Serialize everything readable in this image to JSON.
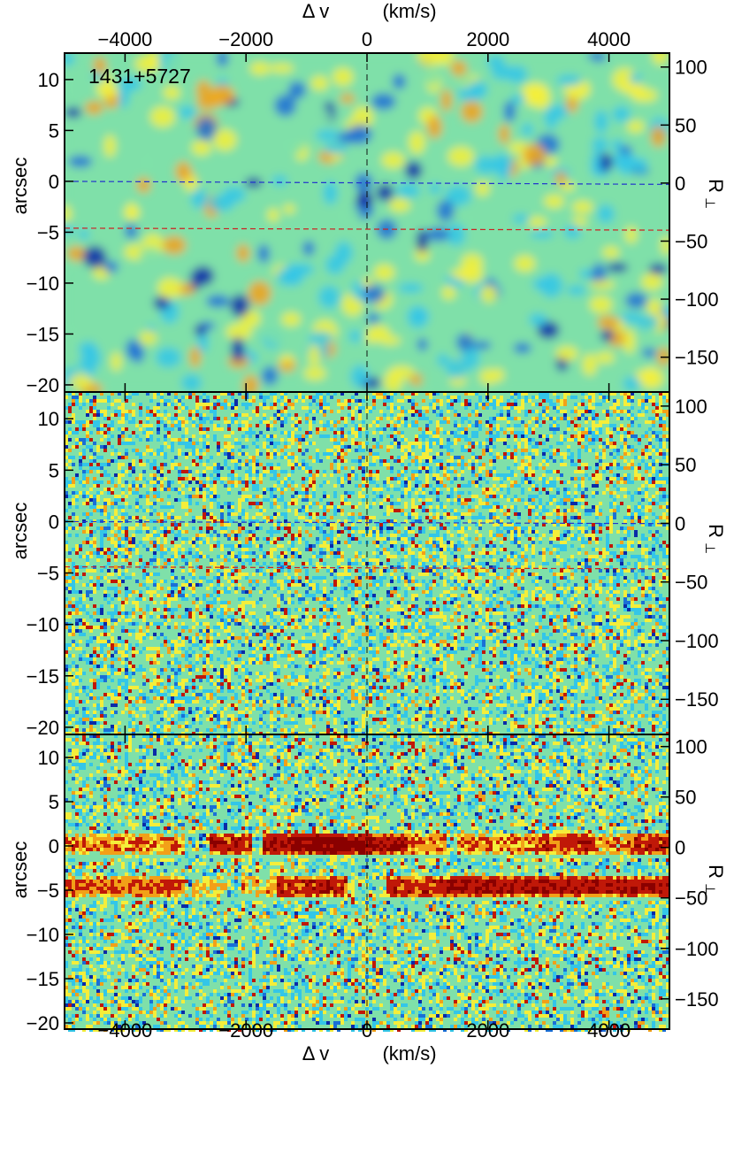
{
  "chart_data": {
    "type": "heatmap",
    "object_label": "1431+5727",
    "colors": {
      "field": "#7fe0a9",
      "blue_dark": "#0a2aa8",
      "blue": "#1a6fd6",
      "cyan": "#33c6e8",
      "yellow": "#f4ee3a",
      "orange": "#f2a018",
      "red": "#c01808",
      "dark_red": "#8a0000",
      "dash_blue": "#2233cc",
      "dash_red": "#cc2222"
    },
    "x_axis": {
      "label_delta": "Δ v",
      "label_units": "(km/s)",
      "range": [
        -5000,
        5000
      ],
      "ticks": [
        -4000,
        -2000,
        0,
        2000,
        4000
      ],
      "tick_labels": [
        "−4000",
        "−2000",
        "0",
        "2000",
        "4000"
      ]
    },
    "y_axis_left": {
      "label": "arcsec",
      "range": [
        -20.7,
        12.6
      ],
      "ticks": [
        10,
        5,
        0,
        -5,
        -10,
        -15,
        -20
      ],
      "tick_labels": [
        "10",
        "5",
        "0",
        "−5",
        "−10",
        "−15",
        "−20"
      ]
    },
    "y_axis_right": {
      "label_main": "R",
      "label_sub": "⊥",
      "range": [
        -180,
        112
      ],
      "ticks": [
        100,
        50,
        0,
        -50,
        -100,
        -150
      ],
      "tick_labels": [
        "100",
        "50",
        "0",
        "−50",
        "−100",
        "−150"
      ]
    },
    "panels": [
      {
        "id": "smoothed",
        "style": "smooth",
        "blue_dashed_line_arcsec": [
          0.0,
          -0.3
        ],
        "red_dashed_line_arcsec": [
          -4.6,
          -4.8
        ],
        "vertical_dashed_line_kms": 0
      },
      {
        "id": "residual",
        "style": "noise",
        "blue_dashed_line_arcsec": [
          0.0,
          -0.2
        ],
        "red_dashed_line_arcsec": [
          -4.4,
          -4.6
        ],
        "vertical_dashed_line_kms": 0
      },
      {
        "id": "raw",
        "style": "noise",
        "emission_bands": [
          {
            "center_arcsec": 0.2,
            "segments": [
              {
                "from_kms": -5000,
                "to_kms": -3000,
                "strength": 0.55
              },
              {
                "from_kms": -2600,
                "to_kms": -1900,
                "strength": 0.85
              },
              {
                "from_kms": -1700,
                "to_kms": 700,
                "strength": 1.0
              },
              {
                "from_kms": 700,
                "to_kms": 1300,
                "strength": 0.6
              },
              {
                "from_kms": 1500,
                "to_kms": 2800,
                "strength": 0.55
              },
              {
                "from_kms": 2800,
                "to_kms": 3800,
                "strength": 0.8
              },
              {
                "from_kms": 3800,
                "to_kms": 4300,
                "strength": 0.5
              },
              {
                "from_kms": 4300,
                "to_kms": 5000,
                "strength": 0.85
              }
            ],
            "peak_kms": -500,
            "peak_halfwidth_kms": 900
          },
          {
            "center_arcsec": -4.6,
            "segments": [
              {
                "from_kms": -5000,
                "to_kms": -3000,
                "strength": 0.7
              },
              {
                "from_kms": -2900,
                "to_kms": -2300,
                "strength": 0.35
              },
              {
                "from_kms": -2100,
                "to_kms": -1500,
                "strength": 0.4
              },
              {
                "from_kms": -1500,
                "to_kms": -300,
                "strength": 0.85
              },
              {
                "from_kms": 300,
                "to_kms": 1200,
                "strength": 0.8
              },
              {
                "from_kms": 1200,
                "to_kms": 5000,
                "strength": 0.95
              }
            ]
          }
        ],
        "vertical_dashed_line_kms": 0
      }
    ]
  }
}
